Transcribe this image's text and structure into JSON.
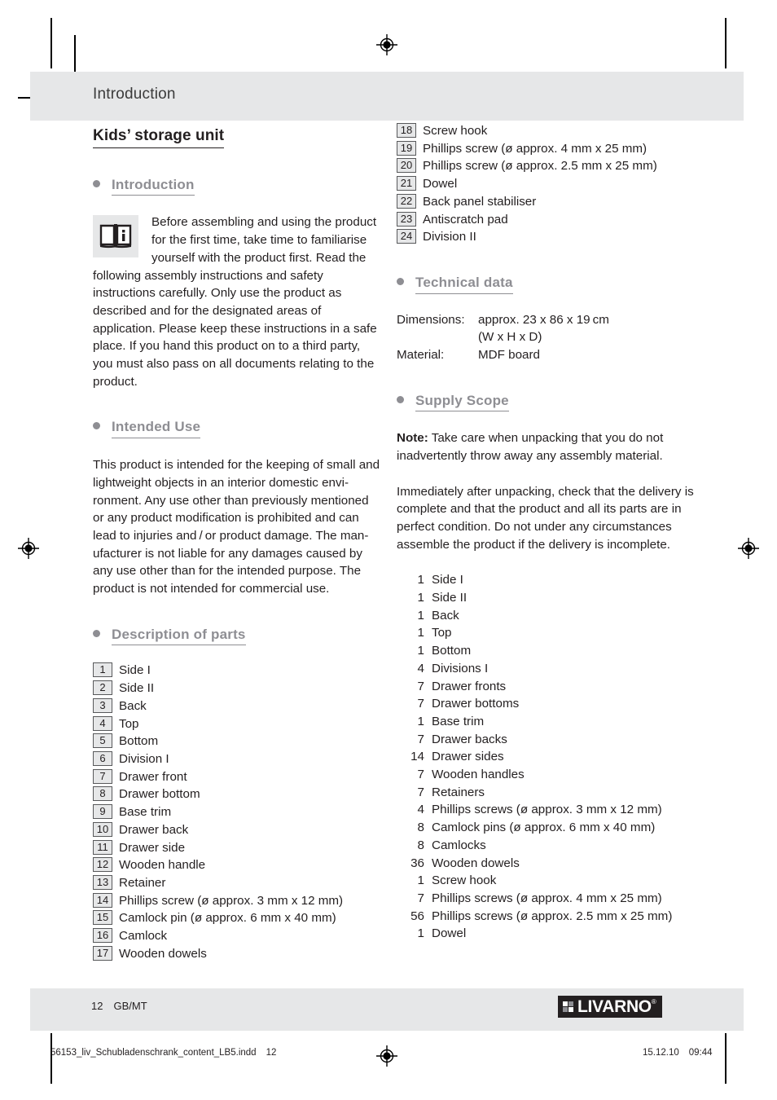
{
  "header": {
    "running_title": "Introduction"
  },
  "document": {
    "title": "Kids’ storage unit"
  },
  "sections": {
    "introduction": {
      "heading": "Introduction",
      "icon": "info-book-icon",
      "paragraph": "Before assembling and using the product for the first time, take time to familiarise yourself with the product first. Read the following assembly instructions and safety instructions carefully. Only use the product as described and for the designated areas of application. Please keep these instructions in a safe place. If you hand this product on to a third party, you must also pass on all documents relating to the product."
    },
    "intended_use": {
      "heading": "Intended Use",
      "paragraph": "This product is intended for the keeping of small and lightweight objects in an interior domestic envi­ronment. Any use other than previously mentioned or any product modification is prohibited and can lead to injuries and / or product damage. The man­ufacturer is not liable for any damages caused by any use other than for the intended purpose. The product is not intended for commercial use."
    },
    "description_of_parts": {
      "heading": "Description of parts",
      "items": [
        {
          "num": "1",
          "label": "Side I"
        },
        {
          "num": "2",
          "label": "Side II"
        },
        {
          "num": "3",
          "label": "Back"
        },
        {
          "num": "4",
          "label": "Top"
        },
        {
          "num": "5",
          "label": "Bottom"
        },
        {
          "num": "6",
          "label": "Division I"
        },
        {
          "num": "7",
          "label": "Drawer front"
        },
        {
          "num": "8",
          "label": "Drawer bottom"
        },
        {
          "num": "9",
          "label": "Base trim"
        },
        {
          "num": "10",
          "label": "Drawer back"
        },
        {
          "num": "11",
          "label": "Drawer side"
        },
        {
          "num": "12",
          "label": "Wooden handle"
        },
        {
          "num": "13",
          "label": "Retainer"
        },
        {
          "num": "14",
          "label": "Phillips screw (ø approx. 3 mm x 12 mm)"
        },
        {
          "num": "15",
          "label": "Camlock pin (ø approx. 6 mm x 40 mm)"
        },
        {
          "num": "16",
          "label": "Camlock"
        },
        {
          "num": "17",
          "label": "Wooden dowels"
        },
        {
          "num": "18",
          "label": "Screw hook"
        },
        {
          "num": "19",
          "label": "Phillips screw (ø approx. 4 mm x 25 mm)"
        },
        {
          "num": "20",
          "label": "Phillips screw (ø approx. 2.5 mm x 25 mm)"
        },
        {
          "num": "21",
          "label": "Dowel"
        },
        {
          "num": "22",
          "label": "Back panel stabiliser"
        },
        {
          "num": "23",
          "label": "Antiscratch pad"
        },
        {
          "num": "24",
          "label": "Division II"
        }
      ]
    },
    "technical_data": {
      "heading": "Technical data",
      "rows": [
        {
          "key": "Dimensions:",
          "value": "approx. 23 x 86 x 19 cm"
        },
        {
          "key": "",
          "value": "(W x H x D)"
        },
        {
          "key": "Material:",
          "value": "MDF board"
        }
      ]
    },
    "supply_scope": {
      "heading": "Supply Scope",
      "note_lead": "Note:",
      "note_text": " Take care when unpacking that you do not inadvertently throw away any assembly material.",
      "paragraph": "Immediately after unpacking, check that the delivery is complete and that the product and all its parts are in perfect condition. Do not under any circumstances assemble the product if the delivery is incomplete.",
      "items": [
        {
          "qty": "1",
          "name": "Side I"
        },
        {
          "qty": "1",
          "name": "Side II"
        },
        {
          "qty": "1",
          "name": "Back"
        },
        {
          "qty": "1",
          "name": "Top"
        },
        {
          "qty": "1",
          "name": "Bottom"
        },
        {
          "qty": "4",
          "name": "Divisions I"
        },
        {
          "qty": "7",
          "name": "Drawer fronts"
        },
        {
          "qty": "7",
          "name": "Drawer bottoms"
        },
        {
          "qty": "1",
          "name": "Base trim"
        },
        {
          "qty": "7",
          "name": "Drawer backs"
        },
        {
          "qty": "14",
          "name": "Drawer sides"
        },
        {
          "qty": "7",
          "name": "Wooden handles"
        },
        {
          "qty": "7",
          "name": "Retainers"
        },
        {
          "qty": "4",
          "name": "Phillips screws (ø approx. 3 mm x 12 mm)"
        },
        {
          "qty": "8",
          "name": "Camlock pins (ø approx. 6 mm x 40 mm)"
        },
        {
          "qty": "8",
          "name": "Camlocks"
        },
        {
          "qty": "36",
          "name": "Wooden dowels"
        },
        {
          "qty": "1",
          "name": "Screw hook"
        },
        {
          "qty": "7",
          "name": "Phillips screws (ø approx. 4 mm x 25 mm)"
        },
        {
          "qty": "56",
          "name": "Phillips screws (ø approx. 2.5 mm x 25 mm)"
        },
        {
          "qty": "1",
          "name": "Dowel"
        }
      ]
    }
  },
  "footer": {
    "page_number": "12",
    "language_code": "GB/MT",
    "brand": "LIVARNO",
    "brand_trademark": "®"
  },
  "print_slug": {
    "filename": "56153_liv_Schubladenschrank_content_LB5.indd",
    "page": "12",
    "date": "15.12.10",
    "time": "09:44"
  },
  "colors": {
    "band_grey": "#e6e7e8",
    "heading_grey": "#8e8e93",
    "text_black": "#231f20",
    "logo_black": "#231f20"
  }
}
